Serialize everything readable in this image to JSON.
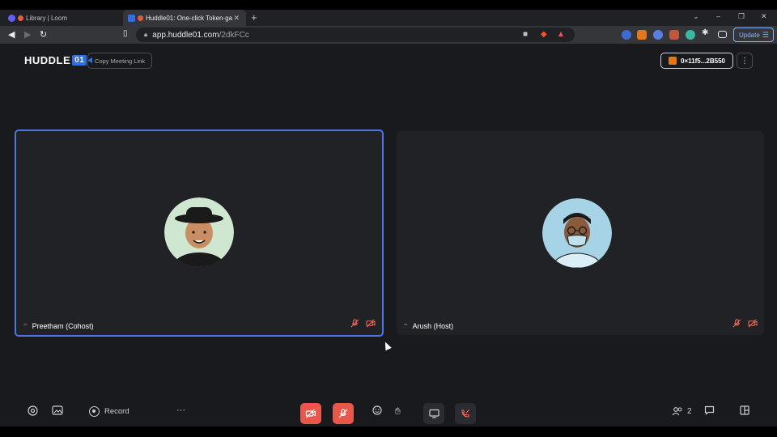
{
  "browser": {
    "tabs": [
      {
        "title": "Library | Loom"
      },
      {
        "title": "Huddle01: One-click Token-ga"
      }
    ],
    "new_tab_glyph": "+",
    "tab_close_glyph": "✕",
    "url_host": "app.huddle01.com",
    "url_path": "/2dkFCc",
    "update_label": "Update"
  },
  "app": {
    "logo_text": "HUDDLE",
    "logo_badge": "01",
    "copy_link_label": "Copy Meeting Link",
    "wallet_address": "0×11f5...2B550",
    "participants": [
      {
        "name": "Preetham (Cohost)",
        "role": "cohost",
        "active_speaker": true,
        "mic_muted": true,
        "camera_off": true
      },
      {
        "name": "Arush (Host)",
        "role": "host",
        "active_speaker": false,
        "mic_muted": true,
        "camera_off": true
      }
    ],
    "bottom_bar": {
      "record_label": "Record",
      "more_glyph": "···",
      "participant_count": "2"
    }
  },
  "colors": {
    "accent": "#4f74e6",
    "danger": "#e9574a",
    "background": "#181a1e",
    "tile": "#202226"
  }
}
